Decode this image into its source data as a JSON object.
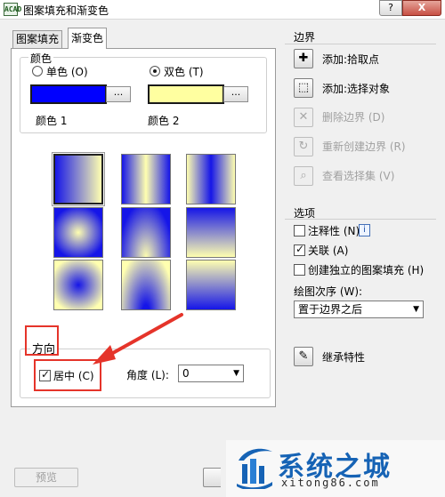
{
  "window": {
    "title": "图案填充和渐变色",
    "app_icon": "ACAD",
    "help": "?",
    "close": "X"
  },
  "tabs": [
    {
      "label": "图案填充"
    },
    {
      "label": "渐变色"
    }
  ],
  "color": {
    "group_title": "颜色",
    "one_color": "单色 (O)",
    "two_color": "双色 (T)",
    "selected_mode": "two_color",
    "color1_label": "颜色 1",
    "color2_label": "颜色 2",
    "color1_value": "#0000ff",
    "color2_value": "#ffffa0",
    "browse": "..."
  },
  "patterns": {
    "selected_index": 0,
    "count": 9
  },
  "orientation": {
    "group_title": "方向",
    "centered_label": "居中 (C)",
    "centered_checked": true,
    "angle_label": "角度 (L):",
    "angle_value": "0"
  },
  "boundaries": {
    "title": "边界",
    "items": [
      {
        "label": "添加:拾取点",
        "icon": "pick-points-icon",
        "enabled": true
      },
      {
        "label": "添加:选择对象",
        "icon": "select-objects-icon",
        "enabled": true
      },
      {
        "label": "删除边界 (D)",
        "icon": "remove-boundary-icon",
        "enabled": false
      },
      {
        "label": "重新创建边界 (R)",
        "icon": "recreate-boundary-icon",
        "enabled": false
      },
      {
        "label": "查看选择集 (V)",
        "icon": "magnifier-icon",
        "enabled": false
      }
    ]
  },
  "options": {
    "title": "选项",
    "annotative": "注释性 (N)",
    "associative": "关联 (A)",
    "independent": "创建独立的图案填充 (H)",
    "draw_order_label": "绘图次序 (W):",
    "draw_order_value": "置于边界之后",
    "info": "i"
  },
  "inherit": {
    "label": "继承特性",
    "icon": "inherit-brush-icon"
  },
  "bottom": {
    "preview": "预览"
  },
  "watermark": {
    "title": "系统之城",
    "url": "xitong86.com"
  },
  "colors": {
    "highlight": "#e5342a",
    "watermark_blue": "#1663b5"
  }
}
